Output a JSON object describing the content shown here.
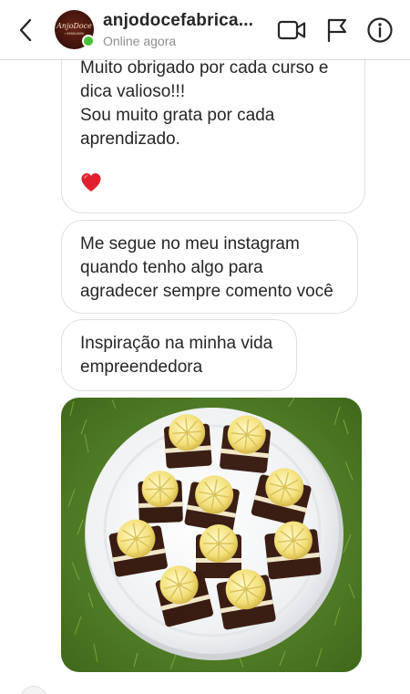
{
  "header": {
    "back_icon": "chevron-left-icon",
    "avatar": {
      "brand": "AnjoDoce",
      "tagline": "• 99965-8096"
    },
    "title": "anjodocefabrica...",
    "status": "Online agora",
    "icons": [
      "video-camera-icon",
      "flag-icon",
      "info-icon"
    ]
  },
  "messages": [
    {
      "lines": [
        "Muito obrigado por cada curso e",
        "dica valioso!!!",
        "Sou muito grata por cada",
        "aprendizado."
      ],
      "emoji": "❤️"
    },
    {
      "text": "Me segue no meu instagram quando tenho algo para agradecer sempre comento você"
    },
    {
      "text": "Inspiração na minha vida empreendedora"
    },
    {
      "type": "photo",
      "description_icon": "photo-brownies-plate"
    }
  ],
  "colors": {
    "online": "#46c136",
    "bubble_border": "#dfdfdf",
    "text": "#262626",
    "muted": "#8e8e8e"
  }
}
